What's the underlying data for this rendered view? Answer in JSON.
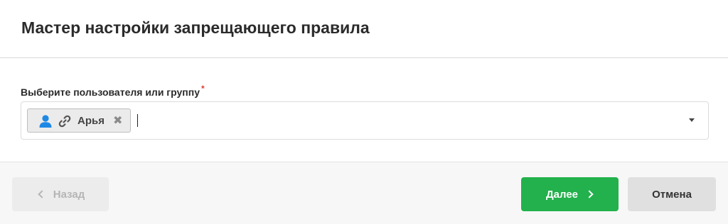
{
  "dialog": {
    "title": "Мастер настройки запрещающего правила"
  },
  "form": {
    "field_label": "Выберите пользователя или группу",
    "required_mark": "*",
    "selected_tags": [
      {
        "label": "Арья",
        "remove_glyph": "✖",
        "icon": "user-icon",
        "secondary_icon": "link-icon"
      }
    ],
    "input_value": ""
  },
  "footer": {
    "back_label": "Назад",
    "next_label": "Далее",
    "cancel_label": "Отмена"
  },
  "colors": {
    "accent": "#22b14c",
    "user_icon": "#1e88e5",
    "required": "#e53935",
    "disabled_text": "#b5b5b5"
  }
}
